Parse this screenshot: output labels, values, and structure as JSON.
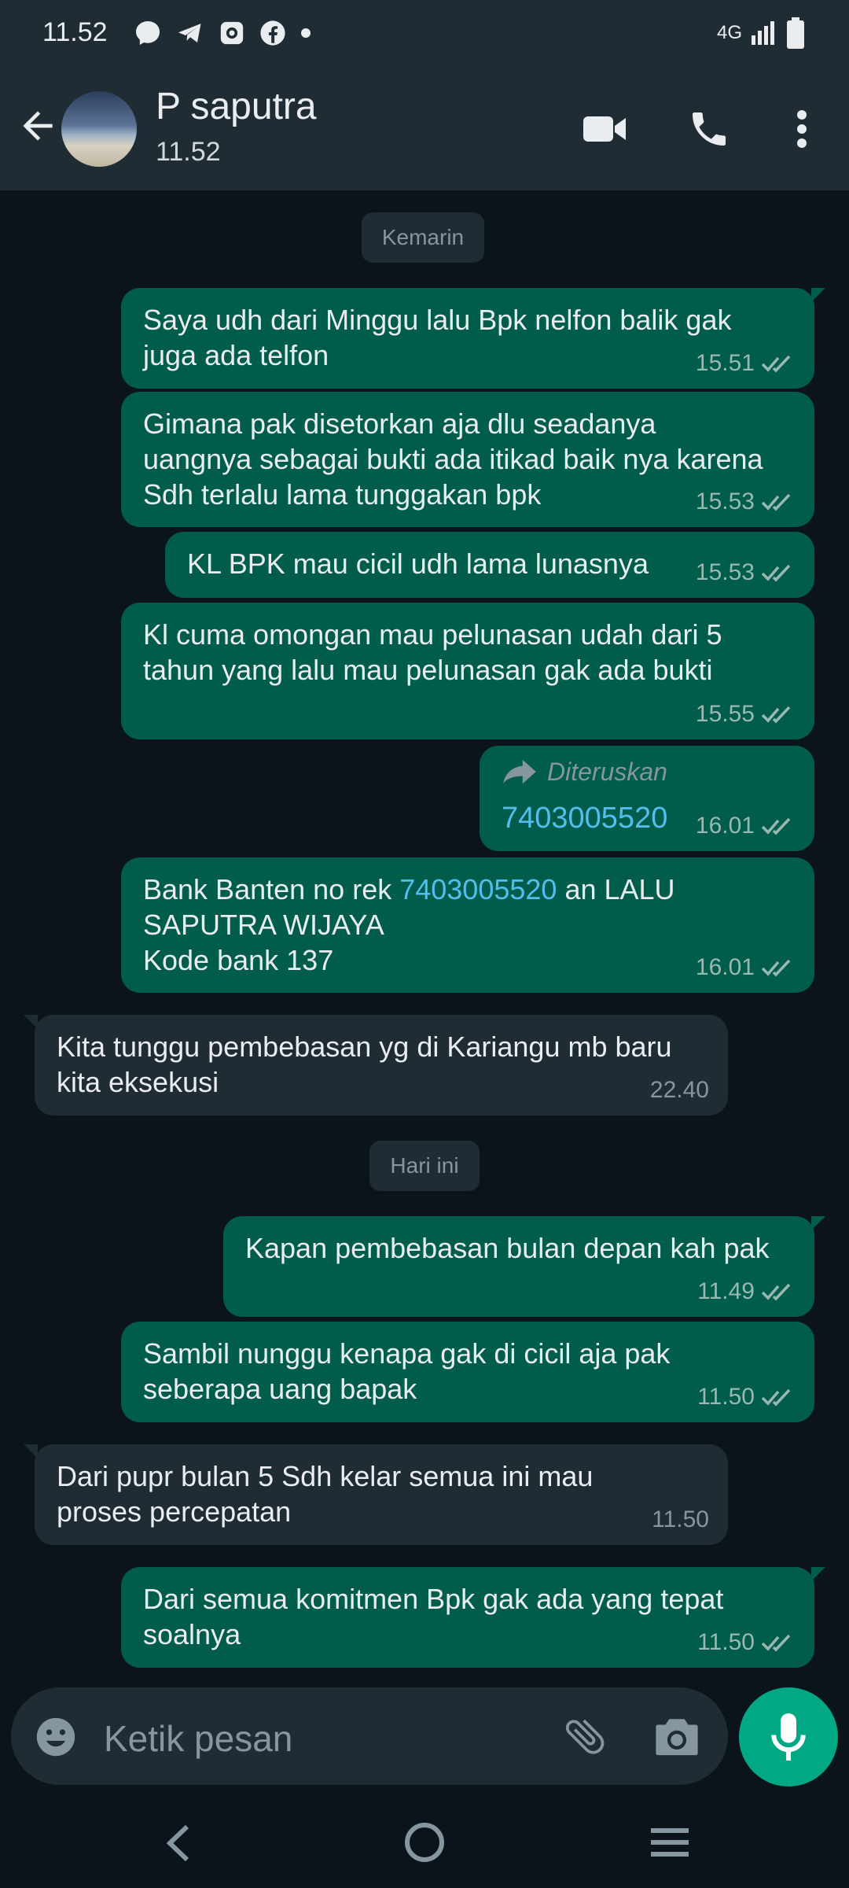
{
  "status_bar": {
    "time": "11.52",
    "network": "4G"
  },
  "header": {
    "contact_name": "P saputra",
    "last_seen": "11.52"
  },
  "chips": {
    "yesterday": "Kemarin",
    "today": "Hari ini"
  },
  "messages": [
    {
      "dir": "out",
      "lines": [
        "Saya udh dari Minggu lalu Bpk nelfon balik gak",
        "juga ada telfon"
      ],
      "time": "15.51"
    },
    {
      "dir": "out",
      "lines": [
        "Gimana pak disetorkan aja dlu seadanya",
        "uangnya sebagai bukti ada itikad baik nya karena",
        "Sdh terlalu lama tunggakan bpk"
      ],
      "time": "15.53"
    },
    {
      "dir": "out",
      "lines": [
        "KL BPK mau cicil udh lama lunasnya"
      ],
      "time": "15.53"
    },
    {
      "dir": "out",
      "lines": [
        "Kl cuma omongan mau pelunasan udah dari 5",
        "tahun yang lalu mau pelunasan gak ada bukti"
      ],
      "time": "15.55"
    },
    {
      "dir": "out",
      "forwarded_label": "Diteruskan",
      "number": "7403005520",
      "time": "16.01"
    },
    {
      "dir": "out",
      "line1_a": "Bank Banten no rek ",
      "line1_link": "7403005520",
      "line1_b": " an LALU",
      "line2": "SAPUTRA WIJAYA",
      "line3": "Kode bank 137",
      "time": "16.01"
    },
    {
      "dir": "in",
      "lines": [
        "Kita tunggu pembebasan yg di Kariangu mb baru",
        "kita eksekusi"
      ],
      "time": "22.40"
    },
    {
      "dir": "out",
      "lines": [
        "Kapan pembebasan bulan depan kah pak"
      ],
      "time": "11.49"
    },
    {
      "dir": "out",
      "lines": [
        "Sambil nunggu kenapa gak di cicil aja pak",
        "seberapa uang bapak"
      ],
      "time": "11.50"
    },
    {
      "dir": "in",
      "lines": [
        "Dari pupr bulan 5 Sdh kelar semua ini mau",
        "proses percepatan"
      ],
      "time": "11.50"
    },
    {
      "dir": "out",
      "lines": [
        "Dari semua komitmen Bpk gak ada yang tepat",
        "soalnya"
      ],
      "time": "11.50"
    }
  ],
  "input": {
    "placeholder": "Ketik pesan"
  },
  "colors": {
    "background": "#0b141a",
    "outgoing": "#005c4b",
    "incoming": "#202c33",
    "accent": "#00a884",
    "link": "#53bdeb"
  },
  "icons": [
    "back-arrow-icon",
    "video-call-icon",
    "phone-icon",
    "more-vert-icon",
    "emoji-icon",
    "attach-icon",
    "camera-icon",
    "mic-icon",
    "double-check-icon",
    "forward-icon"
  ]
}
